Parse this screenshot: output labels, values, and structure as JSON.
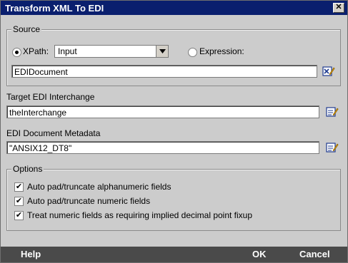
{
  "window": {
    "title": "Transform XML To EDI",
    "close_glyph": "✕"
  },
  "source": {
    "legend": "Source",
    "xpath_label": "XPath:",
    "xpath_selected": "Input",
    "expression_label": "Expression:",
    "value": "EDIDocument"
  },
  "target": {
    "label": "Target EDI Interchange",
    "value": "theInterchange"
  },
  "metadata": {
    "label": "EDI Document Metadata",
    "value": "\"ANSIX12_DT8\""
  },
  "options": {
    "legend": "Options",
    "items": [
      {
        "label": "Auto pad/truncate alphanumeric fields",
        "checked": true
      },
      {
        "label": "Auto pad/truncate numeric fields",
        "checked": true
      },
      {
        "label": "Treat numeric fields as requiring implied decimal point fixup",
        "checked": true
      }
    ]
  },
  "footer": {
    "help": "Help",
    "ok": "OK",
    "cancel": "Cancel"
  },
  "colors": {
    "titlebar": "#0a1f6e",
    "dialog": "#cccccc",
    "footer": "#4a4a4a"
  },
  "icons": {
    "edit": "edit-pencil-icon",
    "xpath_edit": "xpath-edit-icon",
    "dropdown": "chevron-down-icon"
  }
}
